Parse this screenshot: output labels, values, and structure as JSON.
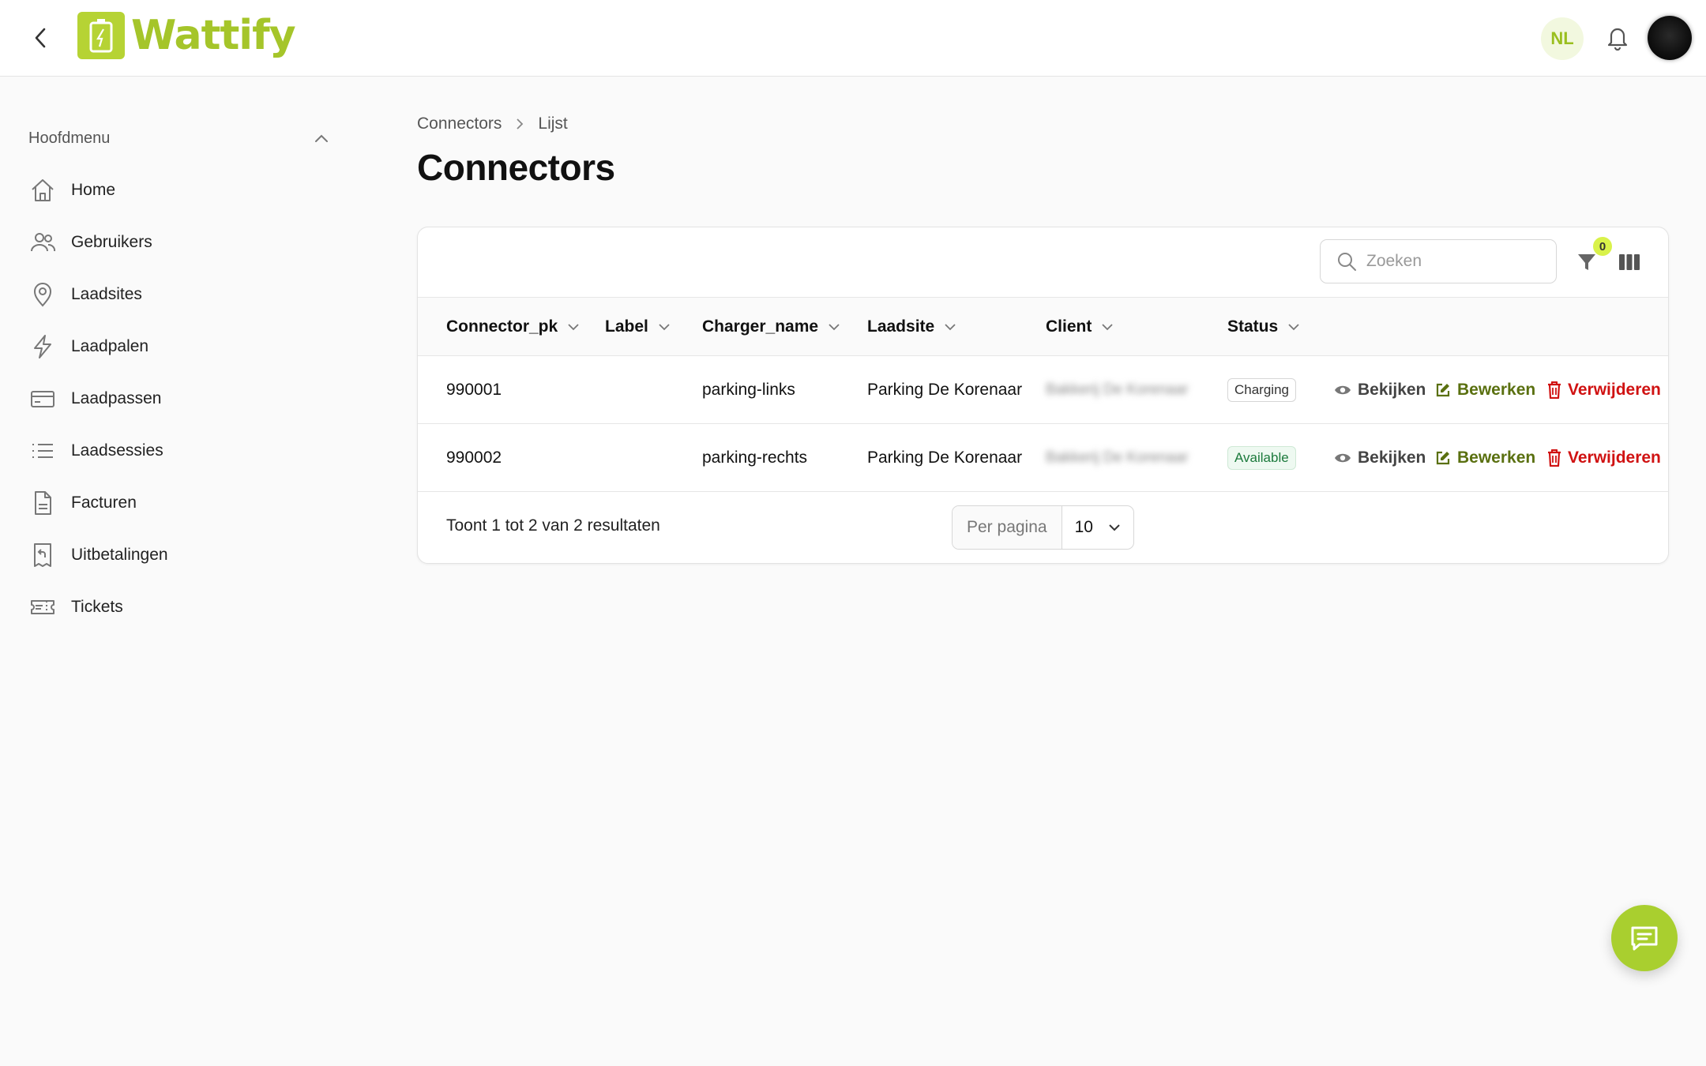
{
  "header": {
    "logo_text": "Wattify",
    "language": "NL",
    "icons": {
      "back": "chevron-left-icon",
      "bell": "bell-icon",
      "avatar": "avatar"
    }
  },
  "sidebar": {
    "menu_title": "Hoofdmenu",
    "items": [
      {
        "label": "Home",
        "icon": "home-icon"
      },
      {
        "label": "Gebruikers",
        "icon": "users-icon"
      },
      {
        "label": "Laadsites",
        "icon": "map-pin-icon"
      },
      {
        "label": "Laadpalen",
        "icon": "lightning-icon"
      },
      {
        "label": "Laadpassen",
        "icon": "credit-card-icon"
      },
      {
        "label": "Laadsessies",
        "icon": "list-icon"
      },
      {
        "label": "Facturen",
        "icon": "document-icon"
      },
      {
        "label": "Uitbetalingen",
        "icon": "receipt-refund-icon"
      },
      {
        "label": "Tickets",
        "icon": "ticket-icon"
      }
    ]
  },
  "breadcrumb": {
    "parent": "Connectors",
    "current": "Lijst"
  },
  "page": {
    "title": "Connectors"
  },
  "table": {
    "search_placeholder": "Zoeken",
    "filter_count": "0",
    "columns": [
      "Connector_pk",
      "Label",
      "Charger_name",
      "Laadsite",
      "Client",
      "Status"
    ],
    "rows": [
      {
        "connector_pk": "990001",
        "label": "",
        "charger_name": "parking-links",
        "laadsite": "Parking De Korenaar",
        "client": "Bakkerij De Korenaar",
        "status": "Charging"
      },
      {
        "connector_pk": "990002",
        "label": "",
        "charger_name": "parking-rechts",
        "laadsite": "Parking De Korenaar",
        "client": "Bakkerij De Korenaar",
        "status": "Available"
      }
    ],
    "actions": {
      "view": "Bekijken",
      "edit": "Bewerken",
      "delete": "Verwijderen"
    },
    "summary": "Toont 1 tot 2 van 2 resultaten",
    "per_page_label": "Per pagina",
    "per_page_value": "10"
  },
  "colors": {
    "brand": "#a9cf2f",
    "edit": "#5a7010",
    "delete": "#d01212"
  }
}
